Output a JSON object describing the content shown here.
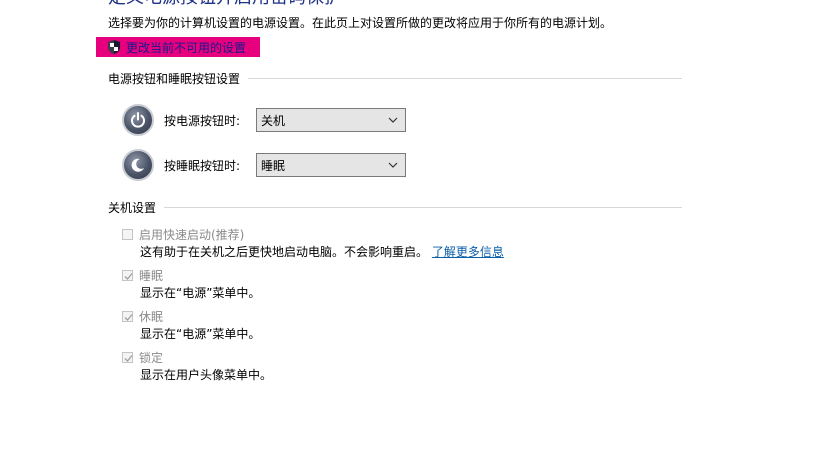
{
  "header": {
    "title": "定义电源按钮并启用密码保护",
    "description": "选择要为你的计算机设置的电源设置。在此页上对设置所做的更改将应用于你所有的电源计划。",
    "change_settings_link": "更改当前不可用的设置",
    "highlight_color": "#e6007e"
  },
  "power_section": {
    "header": "电源按钮和睡眠按钮设置",
    "rows": [
      {
        "label": "按电源按钮时:",
        "value": "关机",
        "icon": "power-icon"
      },
      {
        "label": "按睡眠按钮时:",
        "value": "睡眠",
        "icon": "sleep-moon-icon"
      }
    ]
  },
  "shutdown_section": {
    "header": "关机设置",
    "items": [
      {
        "label": "启用快速启动(推荐)",
        "checked": false,
        "description": "这有助于在关机之后更快地启动电脑。不会影响重启。",
        "link": "了解更多信息"
      },
      {
        "label": "睡眠",
        "checked": true,
        "description": "显示在“电源”菜单中。"
      },
      {
        "label": "休眠",
        "checked": true,
        "description": "显示在“电源”菜单中。"
      },
      {
        "label": "锁定",
        "checked": true,
        "description": "显示在用户头像菜单中。"
      }
    ]
  }
}
